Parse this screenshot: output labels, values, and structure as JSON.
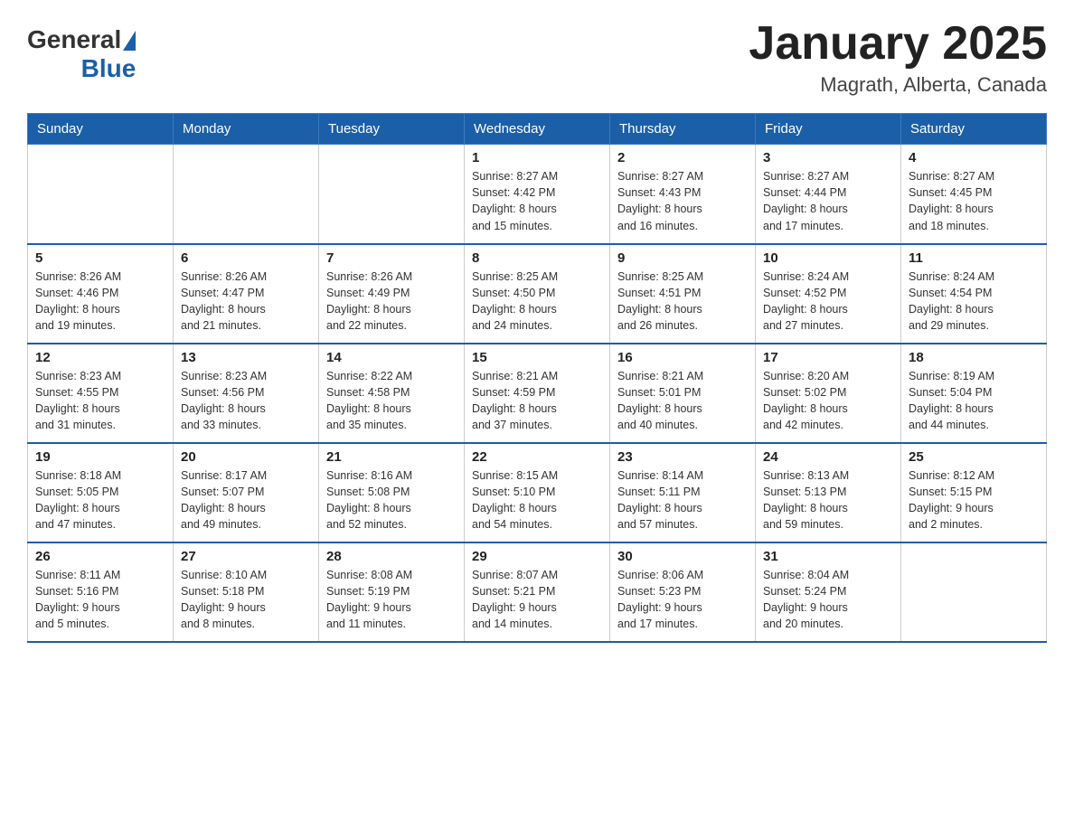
{
  "header": {
    "logo_general": "General",
    "logo_blue": "Blue",
    "title": "January 2025",
    "subtitle": "Magrath, Alberta, Canada"
  },
  "days_of_week": [
    "Sunday",
    "Monday",
    "Tuesday",
    "Wednesday",
    "Thursday",
    "Friday",
    "Saturday"
  ],
  "weeks": [
    [
      {
        "day": "",
        "info": ""
      },
      {
        "day": "",
        "info": ""
      },
      {
        "day": "",
        "info": ""
      },
      {
        "day": "1",
        "info": "Sunrise: 8:27 AM\nSunset: 4:42 PM\nDaylight: 8 hours\nand 15 minutes."
      },
      {
        "day": "2",
        "info": "Sunrise: 8:27 AM\nSunset: 4:43 PM\nDaylight: 8 hours\nand 16 minutes."
      },
      {
        "day": "3",
        "info": "Sunrise: 8:27 AM\nSunset: 4:44 PM\nDaylight: 8 hours\nand 17 minutes."
      },
      {
        "day": "4",
        "info": "Sunrise: 8:27 AM\nSunset: 4:45 PM\nDaylight: 8 hours\nand 18 minutes."
      }
    ],
    [
      {
        "day": "5",
        "info": "Sunrise: 8:26 AM\nSunset: 4:46 PM\nDaylight: 8 hours\nand 19 minutes."
      },
      {
        "day": "6",
        "info": "Sunrise: 8:26 AM\nSunset: 4:47 PM\nDaylight: 8 hours\nand 21 minutes."
      },
      {
        "day": "7",
        "info": "Sunrise: 8:26 AM\nSunset: 4:49 PM\nDaylight: 8 hours\nand 22 minutes."
      },
      {
        "day": "8",
        "info": "Sunrise: 8:25 AM\nSunset: 4:50 PM\nDaylight: 8 hours\nand 24 minutes."
      },
      {
        "day": "9",
        "info": "Sunrise: 8:25 AM\nSunset: 4:51 PM\nDaylight: 8 hours\nand 26 minutes."
      },
      {
        "day": "10",
        "info": "Sunrise: 8:24 AM\nSunset: 4:52 PM\nDaylight: 8 hours\nand 27 minutes."
      },
      {
        "day": "11",
        "info": "Sunrise: 8:24 AM\nSunset: 4:54 PM\nDaylight: 8 hours\nand 29 minutes."
      }
    ],
    [
      {
        "day": "12",
        "info": "Sunrise: 8:23 AM\nSunset: 4:55 PM\nDaylight: 8 hours\nand 31 minutes."
      },
      {
        "day": "13",
        "info": "Sunrise: 8:23 AM\nSunset: 4:56 PM\nDaylight: 8 hours\nand 33 minutes."
      },
      {
        "day": "14",
        "info": "Sunrise: 8:22 AM\nSunset: 4:58 PM\nDaylight: 8 hours\nand 35 minutes."
      },
      {
        "day": "15",
        "info": "Sunrise: 8:21 AM\nSunset: 4:59 PM\nDaylight: 8 hours\nand 37 minutes."
      },
      {
        "day": "16",
        "info": "Sunrise: 8:21 AM\nSunset: 5:01 PM\nDaylight: 8 hours\nand 40 minutes."
      },
      {
        "day": "17",
        "info": "Sunrise: 8:20 AM\nSunset: 5:02 PM\nDaylight: 8 hours\nand 42 minutes."
      },
      {
        "day": "18",
        "info": "Sunrise: 8:19 AM\nSunset: 5:04 PM\nDaylight: 8 hours\nand 44 minutes."
      }
    ],
    [
      {
        "day": "19",
        "info": "Sunrise: 8:18 AM\nSunset: 5:05 PM\nDaylight: 8 hours\nand 47 minutes."
      },
      {
        "day": "20",
        "info": "Sunrise: 8:17 AM\nSunset: 5:07 PM\nDaylight: 8 hours\nand 49 minutes."
      },
      {
        "day": "21",
        "info": "Sunrise: 8:16 AM\nSunset: 5:08 PM\nDaylight: 8 hours\nand 52 minutes."
      },
      {
        "day": "22",
        "info": "Sunrise: 8:15 AM\nSunset: 5:10 PM\nDaylight: 8 hours\nand 54 minutes."
      },
      {
        "day": "23",
        "info": "Sunrise: 8:14 AM\nSunset: 5:11 PM\nDaylight: 8 hours\nand 57 minutes."
      },
      {
        "day": "24",
        "info": "Sunrise: 8:13 AM\nSunset: 5:13 PM\nDaylight: 8 hours\nand 59 minutes."
      },
      {
        "day": "25",
        "info": "Sunrise: 8:12 AM\nSunset: 5:15 PM\nDaylight: 9 hours\nand 2 minutes."
      }
    ],
    [
      {
        "day": "26",
        "info": "Sunrise: 8:11 AM\nSunset: 5:16 PM\nDaylight: 9 hours\nand 5 minutes."
      },
      {
        "day": "27",
        "info": "Sunrise: 8:10 AM\nSunset: 5:18 PM\nDaylight: 9 hours\nand 8 minutes."
      },
      {
        "day": "28",
        "info": "Sunrise: 8:08 AM\nSunset: 5:19 PM\nDaylight: 9 hours\nand 11 minutes."
      },
      {
        "day": "29",
        "info": "Sunrise: 8:07 AM\nSunset: 5:21 PM\nDaylight: 9 hours\nand 14 minutes."
      },
      {
        "day": "30",
        "info": "Sunrise: 8:06 AM\nSunset: 5:23 PM\nDaylight: 9 hours\nand 17 minutes."
      },
      {
        "day": "31",
        "info": "Sunrise: 8:04 AM\nSunset: 5:24 PM\nDaylight: 9 hours\nand 20 minutes."
      },
      {
        "day": "",
        "info": ""
      }
    ]
  ]
}
